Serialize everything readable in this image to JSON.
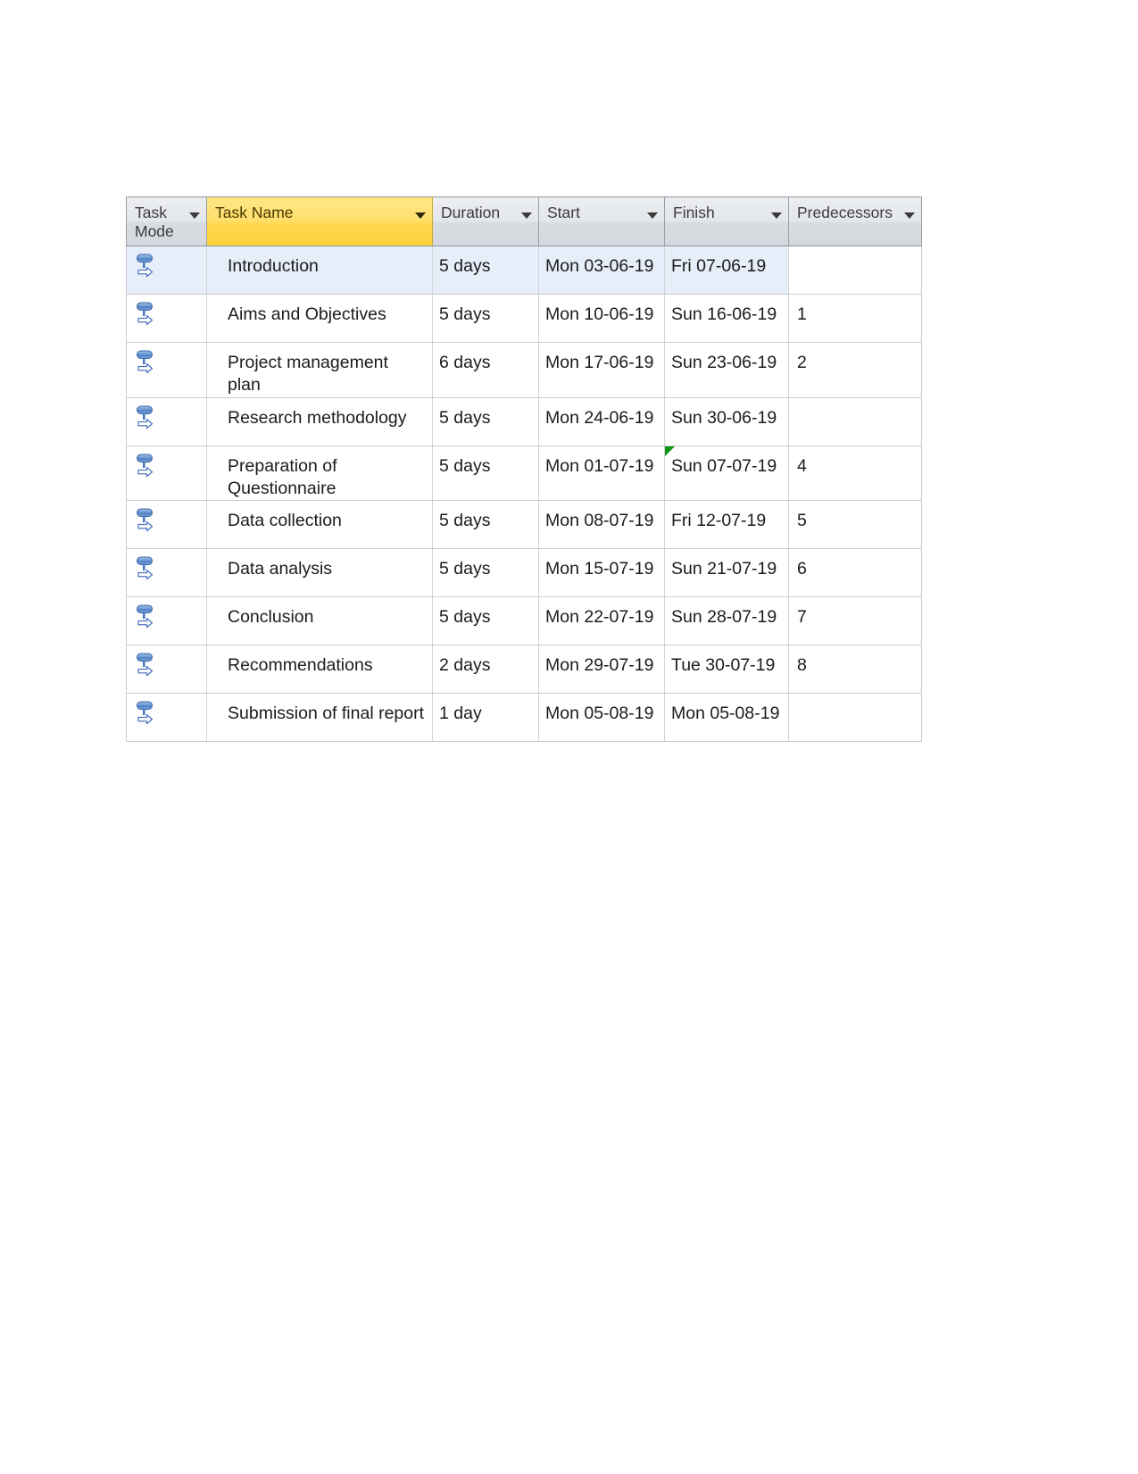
{
  "table": {
    "columns": [
      {
        "key": "task_mode",
        "label": "Task Mode",
        "has_filter": true,
        "accent": "#d9dde2"
      },
      {
        "key": "task_name",
        "label": "Task Name",
        "has_filter": true,
        "accent": "#ffd84f"
      },
      {
        "key": "duration",
        "label": "Duration",
        "has_filter": true,
        "accent": "#d9dde2"
      },
      {
        "key": "start",
        "label": "Start",
        "has_filter": true,
        "accent": "#d9dde2"
      },
      {
        "key": "finish",
        "label": "Finish",
        "has_filter": true,
        "accent": "#d9dde2"
      },
      {
        "key": "predecessors",
        "label": "Predecessors",
        "has_filter": true,
        "accent": "#d9dde2"
      }
    ],
    "rows": [
      {
        "task_mode_icon": "manually-scheduled-icon",
        "task_name": "Introduction",
        "duration": "5 days",
        "start": "Mon 03-06-19",
        "finish": "Fri 07-06-19",
        "predecessors": "",
        "highlighted": true,
        "finish_flag": false
      },
      {
        "task_mode_icon": "manually-scheduled-icon",
        "task_name": "Aims and Objectives",
        "duration": "5 days",
        "start": "Mon 10-06-19",
        "finish": "Sun 16-06-19",
        "predecessors": "1",
        "highlighted": false,
        "finish_flag": false
      },
      {
        "task_mode_icon": "manually-scheduled-icon",
        "task_name": "Project management plan",
        "duration": "6 days",
        "start": "Mon 17-06-19",
        "finish": "Sun 23-06-19",
        "predecessors": "2",
        "highlighted": false,
        "finish_flag": false
      },
      {
        "task_mode_icon": "manually-scheduled-icon",
        "task_name": "Research methodology",
        "duration": "5 days",
        "start": "Mon 24-06-19",
        "finish": "Sun 30-06-19",
        "predecessors": "",
        "highlighted": false,
        "finish_flag": false
      },
      {
        "task_mode_icon": "manually-scheduled-icon",
        "task_name": "Preparation of Questionnaire",
        "duration": "5 days",
        "start": "Mon 01-07-19",
        "finish": "Sun 07-07-19",
        "predecessors": "4",
        "highlighted": false,
        "finish_flag": true
      },
      {
        "task_mode_icon": "manually-scheduled-icon",
        "task_name": "Data collection",
        "duration": "5 days",
        "start": "Mon 08-07-19",
        "finish": "Fri 12-07-19",
        "predecessors": "5",
        "highlighted": false,
        "finish_flag": false
      },
      {
        "task_mode_icon": "manually-scheduled-icon",
        "task_name": "Data analysis",
        "duration": "5 days",
        "start": "Mon 15-07-19",
        "finish": "Sun 21-07-19",
        "predecessors": "6",
        "highlighted": false,
        "finish_flag": false
      },
      {
        "task_mode_icon": "manually-scheduled-icon",
        "task_name": "Conclusion",
        "duration": "5 days",
        "start": "Mon 22-07-19",
        "finish": "Sun 28-07-19",
        "predecessors": "7",
        "highlighted": false,
        "finish_flag": false
      },
      {
        "task_mode_icon": "manually-scheduled-icon",
        "task_name": "Recommendations",
        "duration": "2 days",
        "start": "Mon 29-07-19",
        "finish": "Tue 30-07-19",
        "predecessors": "8",
        "highlighted": false,
        "finish_flag": false
      },
      {
        "task_mode_icon": "manually-scheduled-icon",
        "task_name": "Submission of final report",
        "duration": "1 day",
        "start": "Mon 05-08-19",
        "finish": "Mon 05-08-19",
        "predecessors": "",
        "highlighted": false,
        "finish_flag": false
      }
    ]
  }
}
